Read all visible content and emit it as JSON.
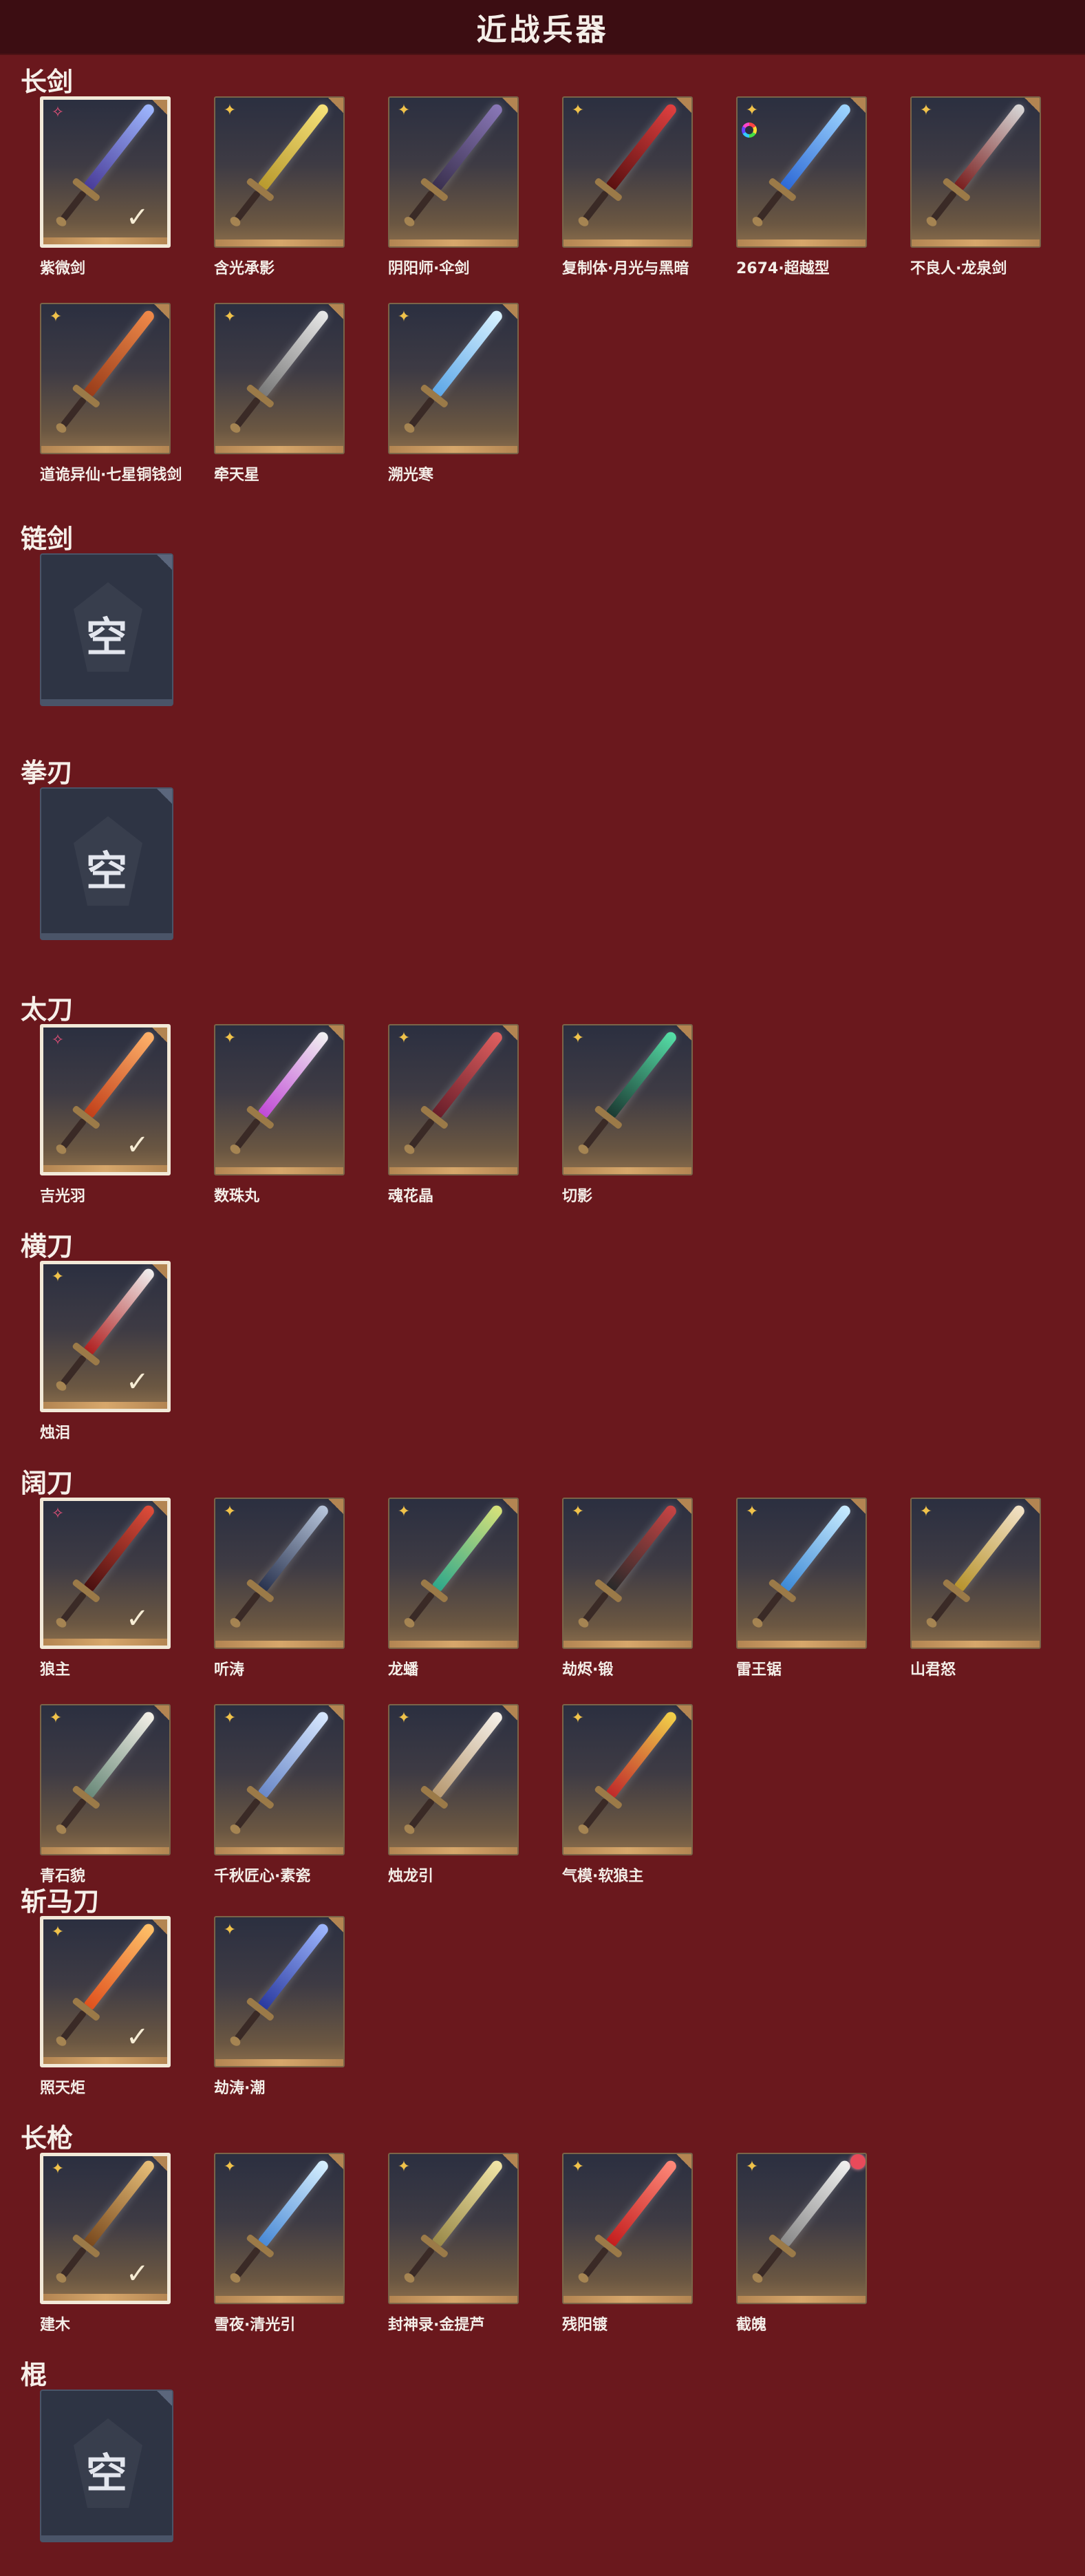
{
  "page_title": "近战兵器",
  "empty_label": "空",
  "categories": [
    {
      "title": "长剑",
      "items": [
        {
          "name": "紫微剑",
          "rarity": "pink-star",
          "equipped": true,
          "blade": [
            "#9fb8ff",
            "#4a3d9a"
          ]
        },
        {
          "name": "含光承影",
          "rarity": "gold-star",
          "equipped": false,
          "blade": [
            "#f6e27a",
            "#b99a2e"
          ]
        },
        {
          "name": "阴阳师·伞剑",
          "rarity": "gold-star",
          "equipped": false,
          "blade": [
            "#8a78b8",
            "#3b3150"
          ]
        },
        {
          "name": "复制体·月光与黑暗",
          "rarity": "gold-star",
          "equipped": false,
          "blade": [
            "#e04040",
            "#5b1010"
          ]
        },
        {
          "name": "2674·超越型",
          "rarity": "gold-star",
          "equipped": false,
          "badge": "rainbow-ring",
          "blade": [
            "#9fd6ff",
            "#2e6ad6"
          ]
        },
        {
          "name": "不良人·龙泉剑",
          "rarity": "gold-star",
          "equipped": false,
          "blade": [
            "#d8d8d8",
            "#7a1f1f"
          ]
        },
        {
          "name": "道诡异仙·七星铜钱剑",
          "rarity": "gold-star",
          "equipped": false,
          "blade": [
            "#f08a4a",
            "#9a3d1a"
          ]
        },
        {
          "name": "牵天星",
          "rarity": "gold-star",
          "equipped": false,
          "blade": [
            "#e8e8e8",
            "#7a7a7a"
          ]
        },
        {
          "name": "溯光寒",
          "rarity": "gold-star",
          "equipped": false,
          "blade": [
            "#d9f2ff",
            "#5ea8e8"
          ]
        }
      ]
    },
    {
      "title": "链剑",
      "items": []
    },
    {
      "title": "拳刃",
      "items": []
    },
    {
      "title": "太刀",
      "items": [
        {
          "name": "吉光羽",
          "rarity": "pink-star",
          "equipped": true,
          "blade": [
            "#ffb36b",
            "#c2401a"
          ]
        },
        {
          "name": "数珠丸",
          "rarity": "gold-star",
          "equipped": false,
          "blade": [
            "#f2f2f2",
            "#c04ad6"
          ]
        },
        {
          "name": "魂花晶",
          "rarity": "gold-star",
          "equipped": false,
          "blade": [
            "#e06060",
            "#6a1e2a"
          ]
        },
        {
          "name": "切影",
          "rarity": "gold-star",
          "equipped": false,
          "blade": [
            "#56e0a8",
            "#1b3b33"
          ]
        }
      ]
    },
    {
      "title": "横刀",
      "items": [
        {
          "name": "烛泪",
          "rarity": "gold-star",
          "equipped": true,
          "blade": [
            "#f0f0f0",
            "#b02020"
          ]
        }
      ]
    },
    {
      "title": "阔刀",
      "items": [
        {
          "name": "狼主",
          "rarity": "pink-star",
          "equipped": true,
          "blade": [
            "#e04d3a",
            "#4a1010"
          ]
        },
        {
          "name": "听涛",
          "rarity": "gold-star",
          "equipped": false,
          "blade": [
            "#b8c6dc",
            "#2a3450"
          ]
        },
        {
          "name": "龙蟠",
          "rarity": "gold-star",
          "equipped": false,
          "blade": [
            "#d8e27a",
            "#2fa88a"
          ]
        },
        {
          "name": "劫烬·锻",
          "rarity": "gold-star",
          "equipped": false,
          "blade": [
            "#c84444",
            "#2a2a2a"
          ]
        },
        {
          "name": "雷王锯",
          "rarity": "gold-star",
          "equipped": false,
          "blade": [
            "#c9ecff",
            "#3e8ad6"
          ]
        },
        {
          "name": "山君怒",
          "rarity": "gold-star",
          "equipped": false,
          "blade": [
            "#f2e2c8",
            "#b8942e"
          ]
        },
        {
          "name": "青石貌",
          "rarity": "gold-star",
          "equipped": false,
          "blade": [
            "#f4f0e8",
            "#6a8a7a"
          ]
        },
        {
          "name": "千秋匠心·素瓷",
          "rarity": "gold-star",
          "equipped": false,
          "blade": [
            "#d8e8ff",
            "#6a88c8"
          ]
        },
        {
          "name": "烛龙引",
          "rarity": "gold-star",
          "equipped": false,
          "blade": [
            "#f6f1ea",
            "#b89a72"
          ]
        },
        {
          "name": "气模·软狼主",
          "rarity": "gold-star",
          "equipped": false,
          "blade": [
            "#f2d24a",
            "#c02a2a"
          ]
        }
      ]
    },
    {
      "title": "斩马刀",
      "items": [
        {
          "name": "照天炬",
          "rarity": "gold-star",
          "equipped": true,
          "blade": [
            "#ffc26a",
            "#e0521e"
          ]
        },
        {
          "name": "劫涛·潮",
          "rarity": "gold-star",
          "equipped": false,
          "blade": [
            "#9fb8ff",
            "#2a3aa0"
          ]
        }
      ]
    },
    {
      "title": "长枪",
      "items": [
        {
          "name": "建木",
          "rarity": "gold-star",
          "equipped": true,
          "blade": [
            "#e8c07a",
            "#7a4a1e"
          ]
        },
        {
          "name": "雪夜·清光引",
          "rarity": "gold-star",
          "equipped": false,
          "blade": [
            "#d8f0ff",
            "#4a8ad6"
          ]
        },
        {
          "name": "封神录·金提芦",
          "rarity": "gold-star",
          "equipped": false,
          "blade": [
            "#f2e6a8",
            "#9a8a4a"
          ]
        },
        {
          "name": "残阳镀",
          "rarity": "gold-star",
          "equipped": false,
          "blade": [
            "#ff8a7a",
            "#c41e1e"
          ]
        },
        {
          "name": "截魄",
          "rarity": "gold-star",
          "equipped": false,
          "badge": "red-dot",
          "blade": [
            "#f0f0f0",
            "#8a8a8a"
          ]
        }
      ]
    },
    {
      "title": "棍",
      "items": []
    }
  ]
}
